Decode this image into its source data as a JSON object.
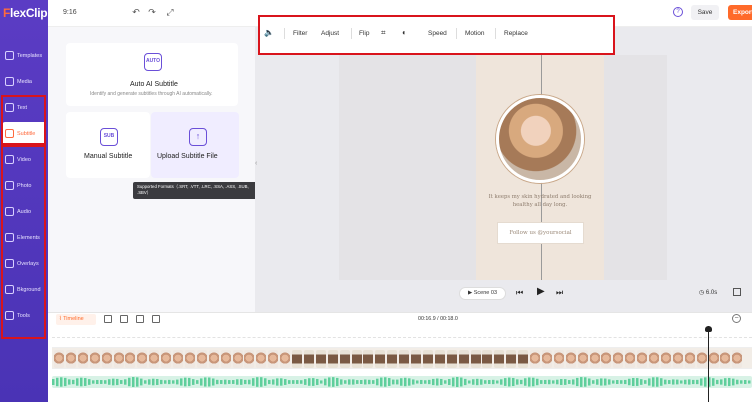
{
  "app": {
    "logo_initial": "F",
    "logo_rest": "lexClip",
    "aspect_ratio": "9:16"
  },
  "topbar": {
    "undo_icon": "undo-icon",
    "redo_icon": "redo-icon",
    "fit_icon": "fit-screen-icon",
    "help_label": "?",
    "save_label": "Save",
    "export_label": "Export"
  },
  "sidebar": {
    "items": [
      {
        "label": "Templates",
        "icon": "templates-icon"
      },
      {
        "label": "Media",
        "icon": "media-icon"
      },
      {
        "label": "Text",
        "icon": "text-icon"
      },
      {
        "label": "Subtitle",
        "icon": "subtitle-icon",
        "active": true
      },
      {
        "label": "Video",
        "icon": "video-icon"
      },
      {
        "label": "Photo",
        "icon": "photo-icon"
      },
      {
        "label": "Audio",
        "icon": "audio-icon"
      },
      {
        "label": "Elements",
        "icon": "elements-icon"
      },
      {
        "label": "Overlays",
        "icon": "overlays-icon"
      },
      {
        "label": "Bkground",
        "icon": "background-icon"
      },
      {
        "label": "Tools",
        "icon": "tools-icon"
      }
    ]
  },
  "panel": {
    "auto_ai": {
      "icon_text": "AUTO",
      "title": "Auto AI Subtitle",
      "subtitle": "Identify and generate subtitles through AI automatically."
    },
    "manual": {
      "icon_text": "SUB",
      "title": "Manual Subtitle"
    },
    "upload": {
      "title": "Upload Subtitle File"
    },
    "tooltip": "Supported Formats（.SRT, .VTT, .LRC, .SSA, .ASS, .SUB, .SBV）"
  },
  "edit_toolbar": {
    "filter": "Filter",
    "adjust": "Adjust",
    "flip": "Flip",
    "speed": "Speed",
    "motion": "Motion",
    "replace": "Replace"
  },
  "canvas": {
    "caption": "It keeps my skin hydrated and looking healthy all day long.",
    "follow": "Follow us @yoursocial"
  },
  "player": {
    "scene": "Scene 03",
    "duration": "6.0s"
  },
  "timeline": {
    "label": "Timeline",
    "time": "00:16.9 / 00:18.0",
    "zoom_out": "−"
  },
  "colors": {
    "brand": "#5b3cc4",
    "accent": "#ff6a2a",
    "highlight": "#d9141c"
  }
}
